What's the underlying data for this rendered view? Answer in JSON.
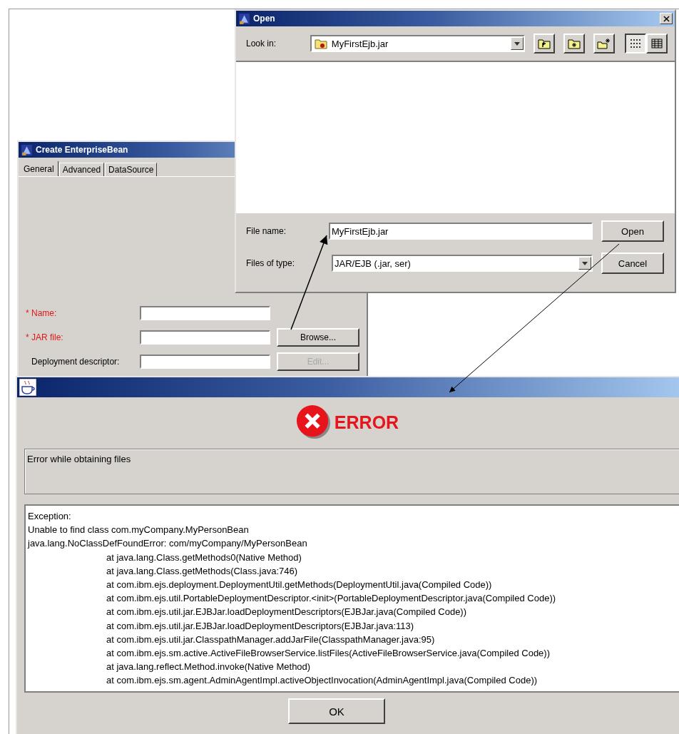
{
  "create_bean_window": {
    "title": "Create EnterpriseBean",
    "tabs": [
      {
        "label": "General",
        "selected": true
      },
      {
        "label": "Advanced",
        "selected": false
      },
      {
        "label": "DataSource",
        "selected": false
      }
    ],
    "fields": [
      {
        "label": "* Name:",
        "required": true
      },
      {
        "label": "* JAR file:",
        "required": true,
        "button": {
          "label": "Browse...",
          "disabled": false
        }
      },
      {
        "label": "Deployment descriptor:",
        "required": false,
        "button": {
          "label": "Edit...",
          "disabled": true
        }
      }
    ]
  },
  "open_dialog": {
    "title": "Open",
    "look_in": {
      "label": "Look in:",
      "value": "MyFirstEjb.jar"
    },
    "file_name": {
      "label": "File name:",
      "value": "MyFirstEjb.jar"
    },
    "files_of_type": {
      "label": "Files of type:",
      "value": "JAR/EJB (.jar, ser)"
    },
    "buttons": [
      "Open",
      "Cancel"
    ]
  },
  "error_dialog": {
    "heading": "ERROR",
    "message": "Error while obtaining files",
    "trace_lines": [
      {
        "text": "Exception:",
        "indented": false
      },
      {
        "text": "Unable to find class com.myCompany.MyPersonBean",
        "indented": false
      },
      {
        "text": "java.lang.NoClassDefFoundError: com/myCompany/MyPersonBean",
        "indented": false
      },
      {
        "text": "at java.lang.Class.getMethods0(Native Method)",
        "indented": true
      },
      {
        "text": "at java.lang.Class.getMethods(Class.java:746)",
        "indented": true
      },
      {
        "text": "at com.ibm.ejs.deployment.DeploymentUtil.getMethods(DeploymentUtil.java(Compiled Code))",
        "indented": true
      },
      {
        "text": "at com.ibm.ejs.util.PortableDeploymentDescriptor.<init>(PortableDeploymentDescriptor.java(Compiled Code))",
        "indented": true
      },
      {
        "text": "at com.ibm.ejs.util.jar.EJBJar.loadDeploymentDescriptors(EJBJar.java(Compiled Code))",
        "indented": true
      },
      {
        "text": "at com.ibm.ejs.util.jar.EJBJar.loadDeploymentDescriptors(EJBJar.java:113)",
        "indented": true
      },
      {
        "text": "at com.ibm.ejs.util.jar.ClasspathManager.addJarFile(ClasspathManager.java:95)",
        "indented": true
      },
      {
        "text": "at com.ibm.ejs.sm.active.ActiveFileBrowserService.listFiles(ActiveFileBrowserService.java(Compiled Code))",
        "indented": true
      },
      {
        "text": "at java.lang.reflect.Method.invoke(Native Method)",
        "indented": true
      },
      {
        "text": "at com.ibm.ejs.sm.agent.AdminAgentImpl.activeObjectInvocation(AdminAgentImpl.java(Compiled Code))",
        "indented": true
      }
    ],
    "ok_button": "OK"
  }
}
